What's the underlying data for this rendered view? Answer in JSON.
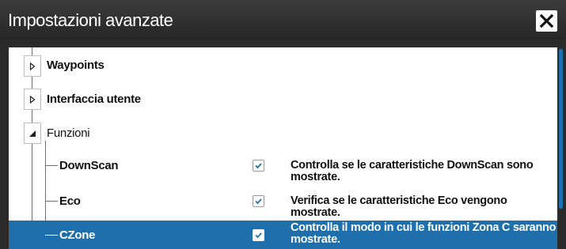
{
  "window": {
    "title": "Impostazioni avanzate",
    "close_icon": "close-icon"
  },
  "tree": {
    "nodes": [
      {
        "label": "Waypoints",
        "state": "collapsed",
        "icon": "expand-triangle-icon"
      },
      {
        "label": "Interfaccia utente",
        "state": "collapsed",
        "icon": "expand-triangle-icon"
      },
      {
        "label": "Funzioni",
        "state": "expanded",
        "icon": "collapse-triangle-icon"
      }
    ],
    "leaves": [
      {
        "label": "DownScan",
        "checked": true,
        "description": "Controlla se le caratteristiche DownScan sono mostrate."
      },
      {
        "label": "Eco",
        "checked": true,
        "description": "Verifica se le caratteristiche Eco vengono mostrate."
      },
      {
        "label": "CZone",
        "checked": true,
        "selected": true,
        "description_line1": "Controlla il modo in cui le funzioni Zona C saranno",
        "description_line2": "mostrate."
      }
    ]
  },
  "colors": {
    "selection": "#1e6fab",
    "titlebar": "#2e2e2e",
    "scrollbar": "#1e71ad"
  }
}
